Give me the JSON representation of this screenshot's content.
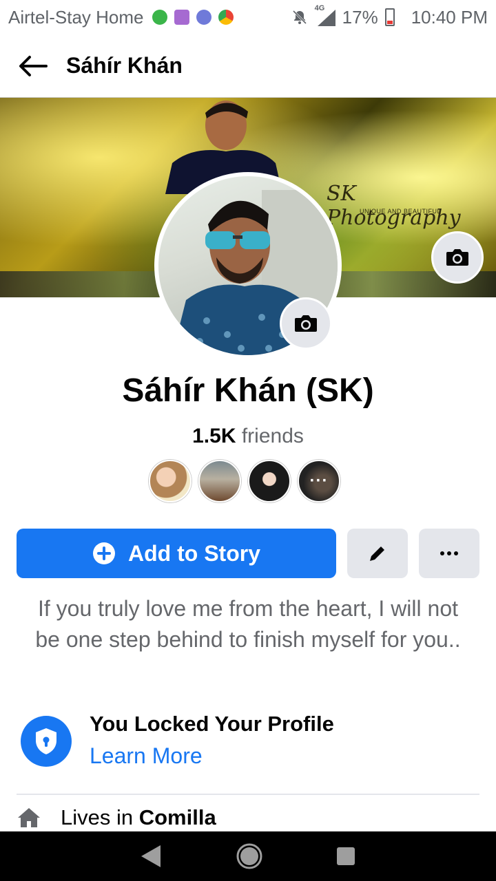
{
  "status_bar": {
    "carrier": "Airtel-Stay Home",
    "network": "4G",
    "battery": "17%",
    "time": "10:40 PM"
  },
  "header": {
    "title": "Sáhír Khán"
  },
  "cover": {
    "watermark_title": "SK Photography",
    "watermark_subtitle": "UNIQUE AND BEAUTIFUL"
  },
  "profile": {
    "name": "Sáhír Khán (SK)",
    "friends_count": "1.5K",
    "friends_label": "friends",
    "bio": "If you truly love me from the heart, I will not be one step behind to finish myself for you..",
    "friend_more_label": "···"
  },
  "actions": {
    "add_story_label": "Add to Story"
  },
  "lock_notice": {
    "title": "You Locked Your Profile",
    "link": "Learn More"
  },
  "details": {
    "lives_prefix": "Lives in",
    "lives_city": "Comilla"
  },
  "colors": {
    "accent": "#1877f2",
    "secondary_button": "#e4e6eb",
    "muted_text": "#65676b"
  }
}
